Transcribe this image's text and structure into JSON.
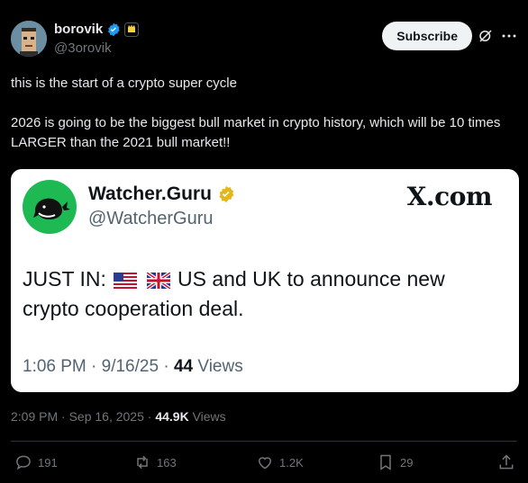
{
  "author": {
    "name": "borovik",
    "handle": "@3orovik",
    "avatar_icon": "pixel-punk-avatar",
    "verified_color": "#1d9bf0"
  },
  "header": {
    "subscribe_label": "Subscribe",
    "grok_icon": "grok-icon",
    "more_icon": "more-icon"
  },
  "tweet": {
    "line1": "this is the start of a crypto super cycle",
    "line2": "2026 is going to be the biggest bull market in crypto history, which will be 10 times LARGER than the 2021 bull market!!"
  },
  "quoted_card": {
    "name": "Watcher.Guru",
    "handle": "@WatcherGuru",
    "brand": "X.com",
    "logo_color": "#1fb954",
    "text_prefix": "JUST IN:",
    "text_body": "US and UK to announce new crypto cooperation deal.",
    "flags": [
      "us-flag-icon",
      "uk-flag-icon"
    ],
    "time": "1:06 PM · 9/16/25 ·",
    "views_count": "44",
    "views_label": "Views"
  },
  "meta": {
    "timestamp": "2:09 PM · Sep 16, 2025 ·",
    "views_count": "44.9K",
    "views_label": "Views"
  },
  "actions": {
    "replies": "191",
    "reposts": "163",
    "likes": "1.2K",
    "bookmarks": "29"
  },
  "colors": {
    "background": "#000000",
    "text": "#e7e9ea",
    "muted": "#71767b",
    "verified": "#1d9bf0"
  }
}
